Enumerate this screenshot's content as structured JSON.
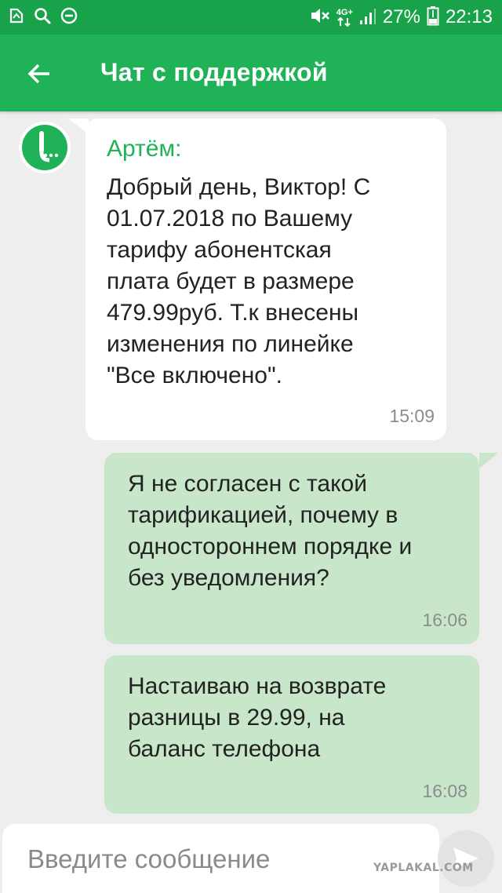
{
  "status_bar": {
    "battery_percent": "27%",
    "time": "22:13",
    "network_label": "4G+",
    "left_icons": [
      "notification-icon",
      "search-icon",
      "do-not-disturb-icon"
    ],
    "right_icons": [
      "mute-icon",
      "network-icon",
      "signal-icon",
      "battery-icon"
    ]
  },
  "toolbar": {
    "title": "Чат с поддержкой",
    "back_icon": "arrow-left-icon"
  },
  "messages": [
    {
      "direction": "incoming",
      "sender": "Артём:",
      "lines": [
        "Добрый день, Виктор! С",
        "01.07.2018 по Вашему",
        "тарифу абонентская",
        "плата будет в размере",
        "479.99руб. Т.к внесены",
        "изменения по линейке",
        "\"Все включено\"."
      ],
      "time": "15:09"
    },
    {
      "direction": "outgoing",
      "lines": [
        "Я не согласен с такой",
        "тарификацией, почему в",
        "одностороннем порядке и",
        "без уведомления?"
      ],
      "time": "16:06"
    },
    {
      "direction": "outgoing",
      "lines": [
        "Настаиваю на возврате",
        "разницы в 29.99, на",
        "баланс телефона"
      ],
      "time": "16:08"
    }
  ],
  "composer": {
    "placeholder": "Введите сообщение",
    "send_icon": "send-icon"
  },
  "watermark": "YAPLAKAL.COM",
  "colors": {
    "status_bar": "#18a24a",
    "toolbar": "#1fb256",
    "incoming_bubble": "#ffffff",
    "outgoing_bubble": "#c8e6c9",
    "sender_name": "#1fb256",
    "background": "#eeeeee"
  }
}
